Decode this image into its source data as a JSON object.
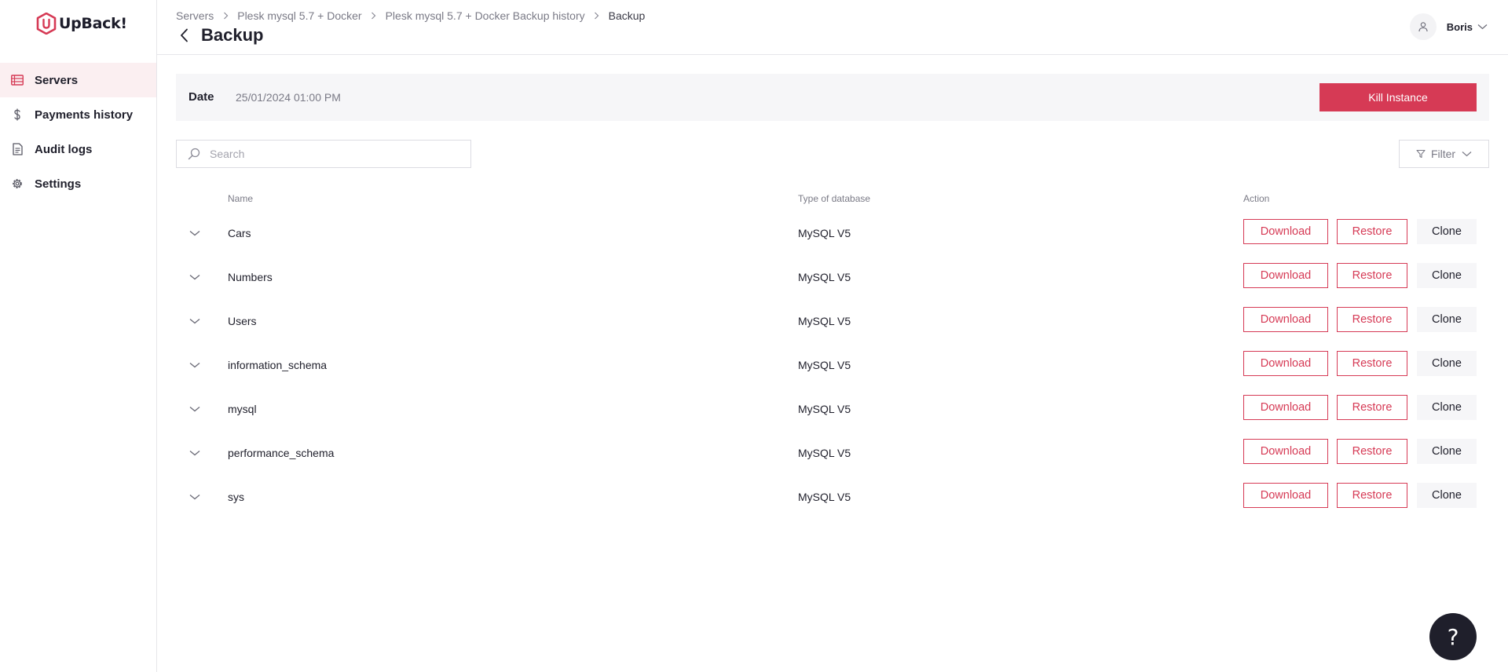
{
  "app": {
    "logo_text": "UpBack!",
    "accent_color": "#d63a55"
  },
  "sidebar": {
    "items": [
      {
        "label": "Servers",
        "icon": "servers-icon",
        "active": true
      },
      {
        "label": "Payments history",
        "icon": "dollar-icon",
        "active": false
      },
      {
        "label": "Audit logs",
        "icon": "document-icon",
        "active": false
      },
      {
        "label": "Settings",
        "icon": "gear-icon",
        "active": false
      }
    ]
  },
  "header": {
    "breadcrumb": [
      "Servers",
      "Plesk mysql 5.7 + Docker",
      "Plesk mysql 5.7 + Docker Backup history",
      "Backup"
    ],
    "title": "Backup",
    "user_name": "Boris"
  },
  "backup_info": {
    "date_label": "Date",
    "date_value": "25/01/2024 01:00 PM",
    "kill_label": "Kill Instance"
  },
  "search": {
    "placeholder": "Search",
    "value": ""
  },
  "filter": {
    "label": "Filter"
  },
  "table": {
    "columns": {
      "name": "Name",
      "type": "Type of database",
      "action": "Action"
    },
    "actions": {
      "download": "Download",
      "restore": "Restore",
      "clone": "Clone"
    },
    "rows": [
      {
        "name": "Cars",
        "type": "MySQL V5"
      },
      {
        "name": "Numbers",
        "type": "MySQL V5"
      },
      {
        "name": "Users",
        "type": "MySQL V5"
      },
      {
        "name": "information_schema",
        "type": "MySQL V5"
      },
      {
        "name": "mysql",
        "type": "MySQL V5"
      },
      {
        "name": "performance_schema",
        "type": "MySQL V5"
      },
      {
        "name": "sys",
        "type": "MySQL V5"
      }
    ]
  },
  "help": {
    "label": "?"
  }
}
